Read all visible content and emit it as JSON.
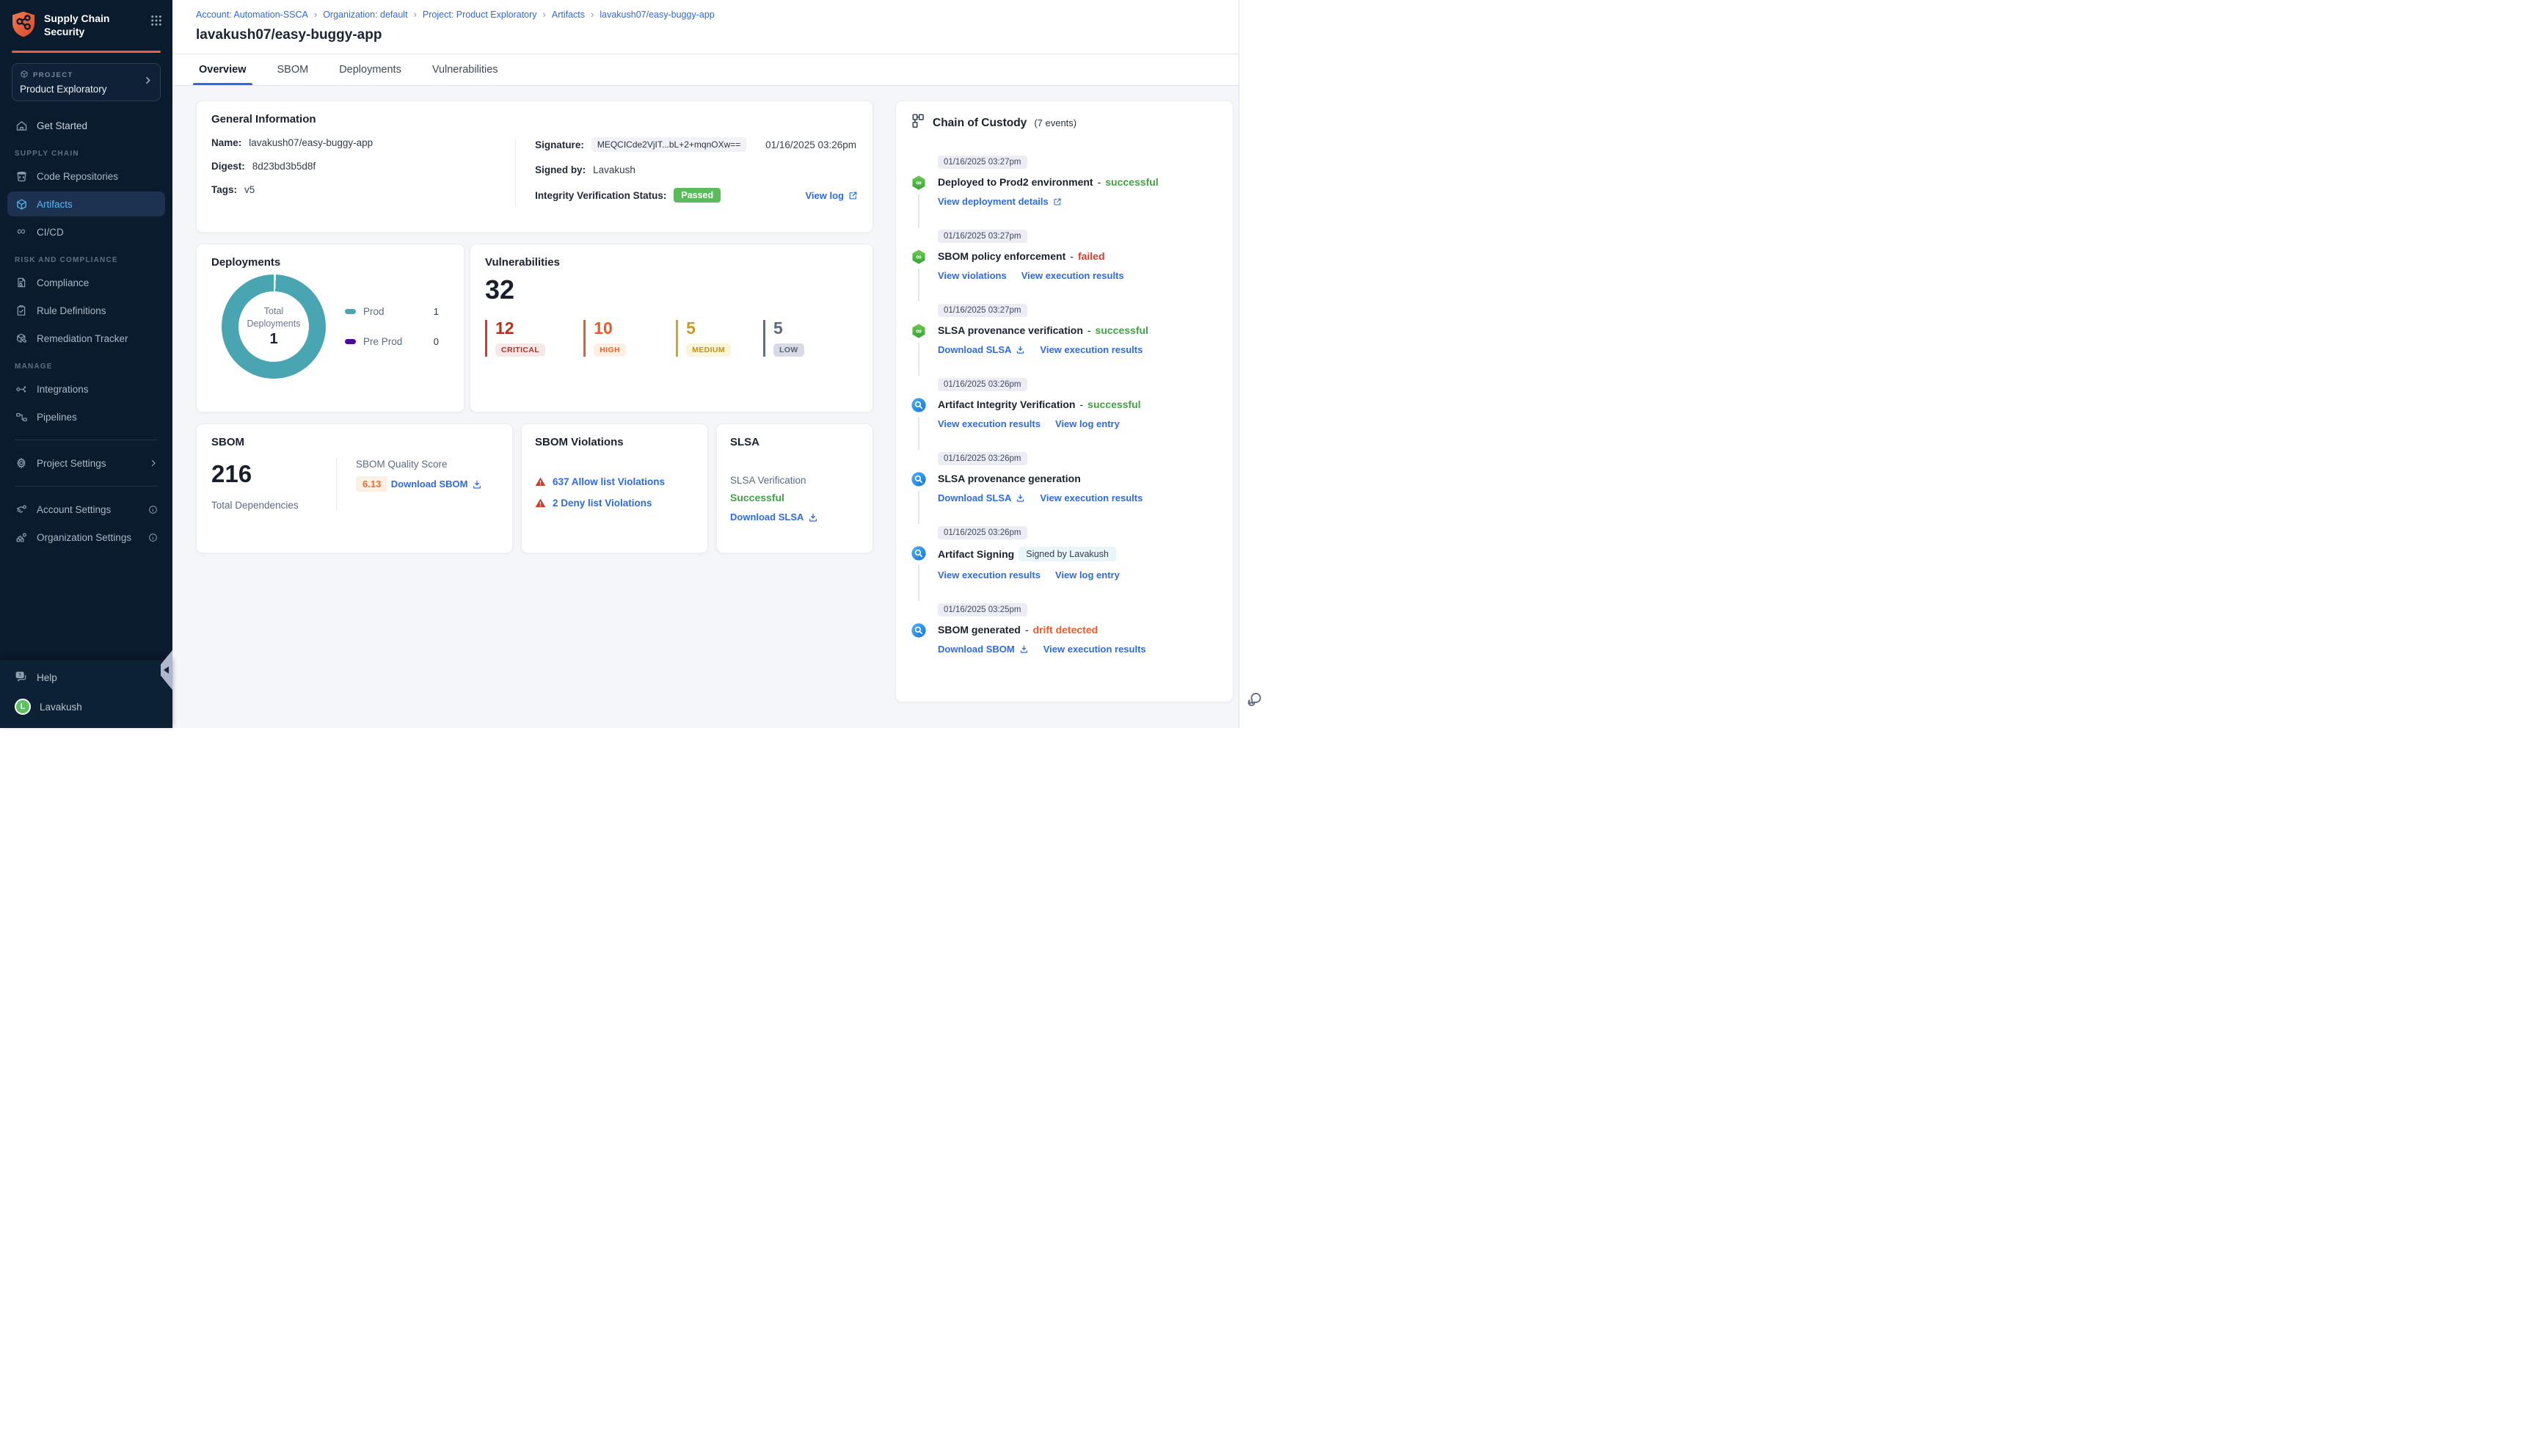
{
  "brand": {
    "name": "Supply Chain Security",
    "accent": "#ED5F3B"
  },
  "project_selector": {
    "label": "PROJECT",
    "value": "Product Exploratory"
  },
  "sidebar": {
    "get_started": "Get Started",
    "section_supply_chain": "SUPPLY CHAIN",
    "code_repositories": "Code Repositories",
    "artifacts": "Artifacts",
    "cicd": "CI/CD",
    "section_risk": "RISK AND COMPLIANCE",
    "compliance": "Compliance",
    "rule_definitions": "Rule Definitions",
    "remediation_tracker": "Remediation Tracker",
    "section_manage": "MANAGE",
    "integrations": "Integrations",
    "pipelines": "Pipelines",
    "project_settings": "Project Settings",
    "account_settings": "Account Settings",
    "organization_settings": "Organization Settings",
    "help": "Help",
    "user": {
      "name": "Lavakush",
      "initial": "L",
      "avatar_color": "#5CC15E"
    },
    "active_item": "Artifacts"
  },
  "breadcrumb": {
    "separator": "›",
    "items": [
      "Account: Automation-SSCA",
      "Organization: default",
      "Project: Product Exploratory",
      "Artifacts",
      "lavakush07/easy-buggy-app"
    ]
  },
  "page": {
    "title": "lavakush07/easy-buggy-app"
  },
  "tabs": {
    "items": [
      "Overview",
      "SBOM",
      "Deployments",
      "Vulnerabilities"
    ],
    "active": "Overview"
  },
  "general_info": {
    "title": "General Information",
    "name_label": "Name:",
    "name": "lavakush07/easy-buggy-app",
    "digest_label": "Digest:",
    "digest": "8d23bd3b5d8f",
    "tags_label": "Tags:",
    "tags": "v5",
    "signature_label": "Signature:",
    "signature": "MEQCICde2VjIT...bL+2+mqnOXw==",
    "signature_time": "01/16/2025 03:26pm",
    "signed_by_label": "Signed by:",
    "signed_by": "Lavakush",
    "integrity_label": "Integrity Verification Status:",
    "integrity_status": "Passed",
    "view_log": "View log"
  },
  "deployments": {
    "title": "Deployments",
    "center_label": "Total Deployments",
    "total": "1",
    "legend": [
      {
        "label": "Prod",
        "value": "1",
        "color": "#4AA5B2"
      },
      {
        "label": "Pre Prod",
        "value": "0",
        "color": "#4C0B96"
      }
    ]
  },
  "vulnerabilities": {
    "title": "Vulnerabilities",
    "total": "32",
    "severities": [
      {
        "label": "CRITICAL",
        "count": "12",
        "color": "#B5311F"
      },
      {
        "label": "HIGH",
        "count": "10",
        "color": "#E85B2B"
      },
      {
        "label": "MEDIUM",
        "count": "5",
        "color": "#C79B26"
      },
      {
        "label": "LOW",
        "count": "5",
        "color": "#5C6880"
      }
    ]
  },
  "sbom": {
    "title": "SBOM",
    "total": "216",
    "total_label": "Total Dependencies",
    "quality_label": "SBOM Quality Score",
    "quality_score": "6.13",
    "download_label": "Download SBOM"
  },
  "sbom_violations": {
    "title": "SBOM Violations",
    "items": [
      {
        "text": "637 Allow list Violations"
      },
      {
        "text": "2 Deny list Violations"
      }
    ]
  },
  "slsa": {
    "title": "SLSA",
    "verification_label": "SLSA Verification",
    "status": "Successful",
    "download_label": "Download SLSA"
  },
  "chain_of_custody": {
    "title": "Chain of Custody",
    "events_count": "(7 events)",
    "events": [
      {
        "time": "01/16/2025 03:27pm",
        "icon": "pipeline",
        "title": "Deployed to Prod2 environment",
        "separator": "-",
        "status": "successful",
        "status_type": "success",
        "links": [
          {
            "label": "View deployment details",
            "icon": "external"
          }
        ]
      },
      {
        "time": "01/16/2025 03:27pm",
        "icon": "pipeline",
        "title": "SBOM policy enforcement",
        "separator": "-",
        "status": "failed",
        "status_type": "fail",
        "links": [
          {
            "label": "View violations"
          },
          {
            "label": "View execution results"
          }
        ]
      },
      {
        "time": "01/16/2025 03:27pm",
        "icon": "pipeline",
        "title": "SLSA provenance verification",
        "separator": "-",
        "status": "successful",
        "status_type": "success",
        "links": [
          {
            "label": "Download SLSA",
            "icon": "download"
          },
          {
            "label": "View execution results"
          }
        ]
      },
      {
        "time": "01/16/2025 03:26pm",
        "icon": "scan",
        "title": "Artifact Integrity Verification",
        "separator": "-",
        "status": "successful",
        "status_type": "success",
        "links": [
          {
            "label": "View execution results"
          },
          {
            "label": "View log entry"
          }
        ]
      },
      {
        "time": "01/16/2025 03:26pm",
        "icon": "scan",
        "title": "SLSA provenance generation",
        "links": [
          {
            "label": "Download SLSA",
            "icon": "download"
          },
          {
            "label": "View execution results"
          }
        ]
      },
      {
        "time": "01/16/2025 03:26pm",
        "icon": "scan",
        "title": "Artifact Signing",
        "chip": "Signed by Lavakush",
        "links": [
          {
            "label": "View execution results"
          },
          {
            "label": "View log entry"
          }
        ]
      },
      {
        "time": "01/16/2025 03:25pm",
        "icon": "scan",
        "title": "SBOM generated",
        "separator": "-",
        "status": "drift detected",
        "status_type": "warn",
        "links": [
          {
            "label": "Download SBOM",
            "icon": "download"
          },
          {
            "label": "View execution results"
          }
        ]
      }
    ]
  },
  "colors": {
    "accent_orange": "#ED5F3B",
    "link_blue": "#2F6BDD",
    "success_green": "#43A047",
    "fail_red": "#D63A2F",
    "drift_orange": "#ED5C2C",
    "passed_badge": "#5CBB5C",
    "prod_teal": "#4AA5B2",
    "preprod_purple": "#4C0B96",
    "sidebar_bg": "#0B1B2E",
    "active_nav": "#57B7F6"
  }
}
